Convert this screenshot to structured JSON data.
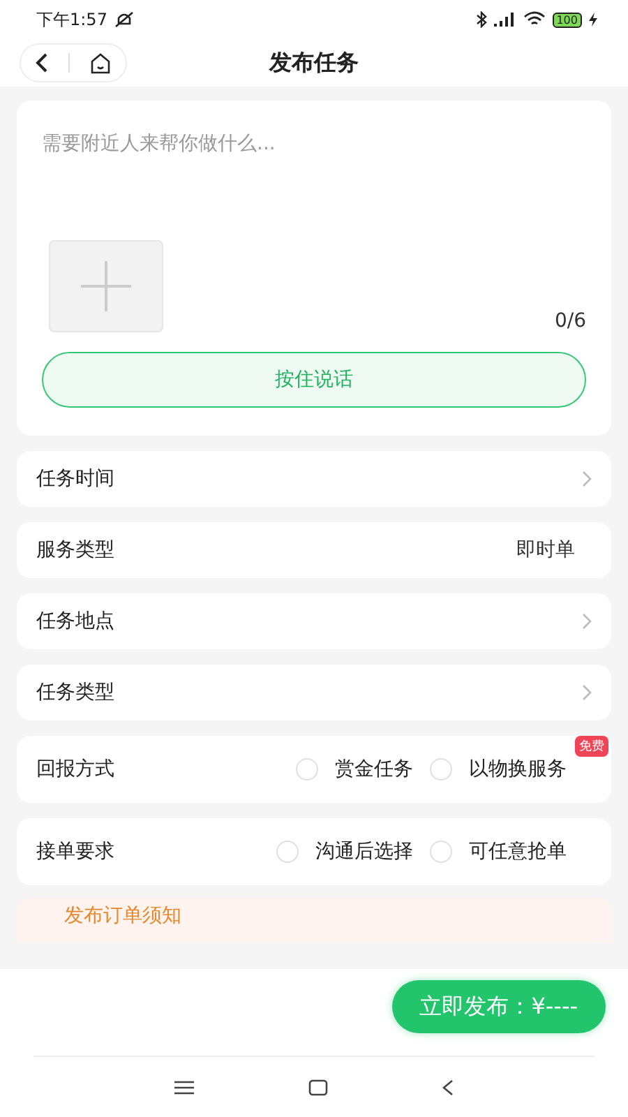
{
  "status_bar": {
    "time": "下午1:57",
    "battery": "100"
  },
  "header": {
    "title": "发布任务"
  },
  "description": {
    "placeholder": "需要附近人来帮你做什么...",
    "photo_count": "0/6",
    "voice_button": "按住说话"
  },
  "rows": [
    {
      "kind": "arrow",
      "label": "任务时间"
    },
    {
      "kind": "value",
      "label": "服务类型",
      "value": "即时单"
    },
    {
      "kind": "arrow",
      "label": "任务地点"
    },
    {
      "kind": "arrow",
      "label": "任务类型"
    },
    {
      "kind": "radio",
      "label": "回报方式",
      "options": [
        {
          "label": "赏金任务",
          "checked": false
        },
        {
          "label": "以物换服务",
          "checked": false,
          "badge": "免费"
        }
      ]
    },
    {
      "kind": "radio",
      "label": "接单要求",
      "options": [
        {
          "label": "沟通后选择",
          "checked": false
        },
        {
          "label": "可任意抢单",
          "checked": false
        }
      ]
    }
  ],
  "notice": {
    "title": "发布订单须知"
  },
  "publish_button": "立即发布：¥----"
}
